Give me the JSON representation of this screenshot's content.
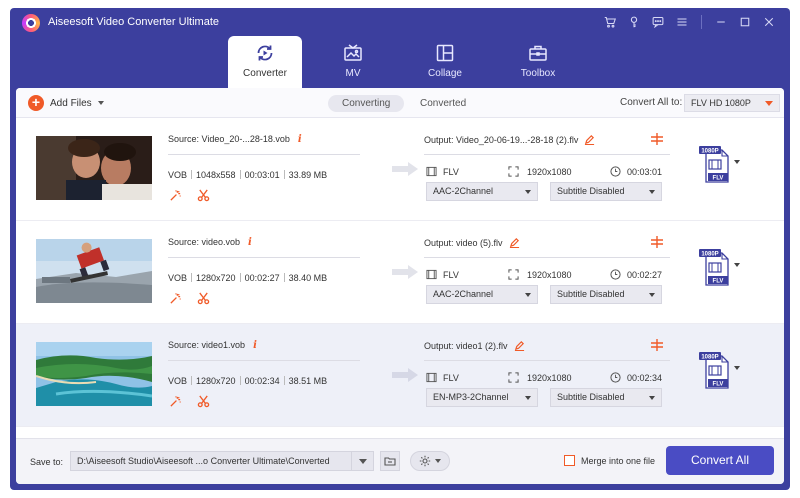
{
  "app": {
    "title": "Aiseesoft Video Converter Ultimate",
    "accent": "#f05a28",
    "brand": "#3c3f9e"
  },
  "titlebar_icons": [
    "cart-icon",
    "key-icon",
    "chat-icon",
    "menu-icon",
    "minimize-icon",
    "maximize-icon",
    "close-icon"
  ],
  "nav": {
    "tabs": [
      {
        "label": "Converter",
        "icon": "converter-icon",
        "active": true
      },
      {
        "label": "MV",
        "icon": "mv-icon",
        "active": false
      },
      {
        "label": "Collage",
        "icon": "collage-icon",
        "active": false
      },
      {
        "label": "Toolbox",
        "icon": "toolbox-icon",
        "active": false
      }
    ]
  },
  "toolbar": {
    "add_files": "Add Files",
    "tab_converting": "Converting",
    "tab_converted": "Converted",
    "convert_all_to": "Convert All to:",
    "format": "FLV HD 1080P"
  },
  "files": [
    {
      "source": "Source: Video_20-...28-18.vob",
      "format": "VOB",
      "resolution": "1048x558",
      "duration": "00:03:01",
      "size": "33.89 MB",
      "output": "Output: Video_20-06-19...-28-18 (2).flv",
      "out_format": "FLV",
      "out_resolution": "1920x1080",
      "out_duration": "00:03:01",
      "audio": "AAC-2Channel",
      "subtitle": "Subtitle Disabled",
      "badge_top": "1080P",
      "badge_bottom": "FLV"
    },
    {
      "source": "Source: video.vob",
      "format": "VOB",
      "resolution": "1280x720",
      "duration": "00:02:27",
      "size": "38.40 MB",
      "output": "Output: video (5).flv",
      "out_format": "FLV",
      "out_resolution": "1920x1080",
      "out_duration": "00:02:27",
      "audio": "AAC-2Channel",
      "subtitle": "Subtitle Disabled",
      "badge_top": "1080P",
      "badge_bottom": "FLV"
    },
    {
      "source": "Source: video1.vob",
      "format": "VOB",
      "resolution": "1280x720",
      "duration": "00:02:34",
      "size": "38.51 MB",
      "output": "Output: video1 (2).flv",
      "out_format": "FLV",
      "out_resolution": "1920x1080",
      "out_duration": "00:02:34",
      "audio": "EN-MP3-2Channel",
      "subtitle": "Subtitle Disabled",
      "badge_top": "1080P",
      "badge_bottom": "FLV"
    }
  ],
  "footer": {
    "save_to": "Save to:",
    "path": "D:\\Aiseesoft Studio\\Aiseesoft ...o Converter Ultimate\\Converted",
    "merge": "Merge into one file",
    "convert_all": "Convert All"
  }
}
